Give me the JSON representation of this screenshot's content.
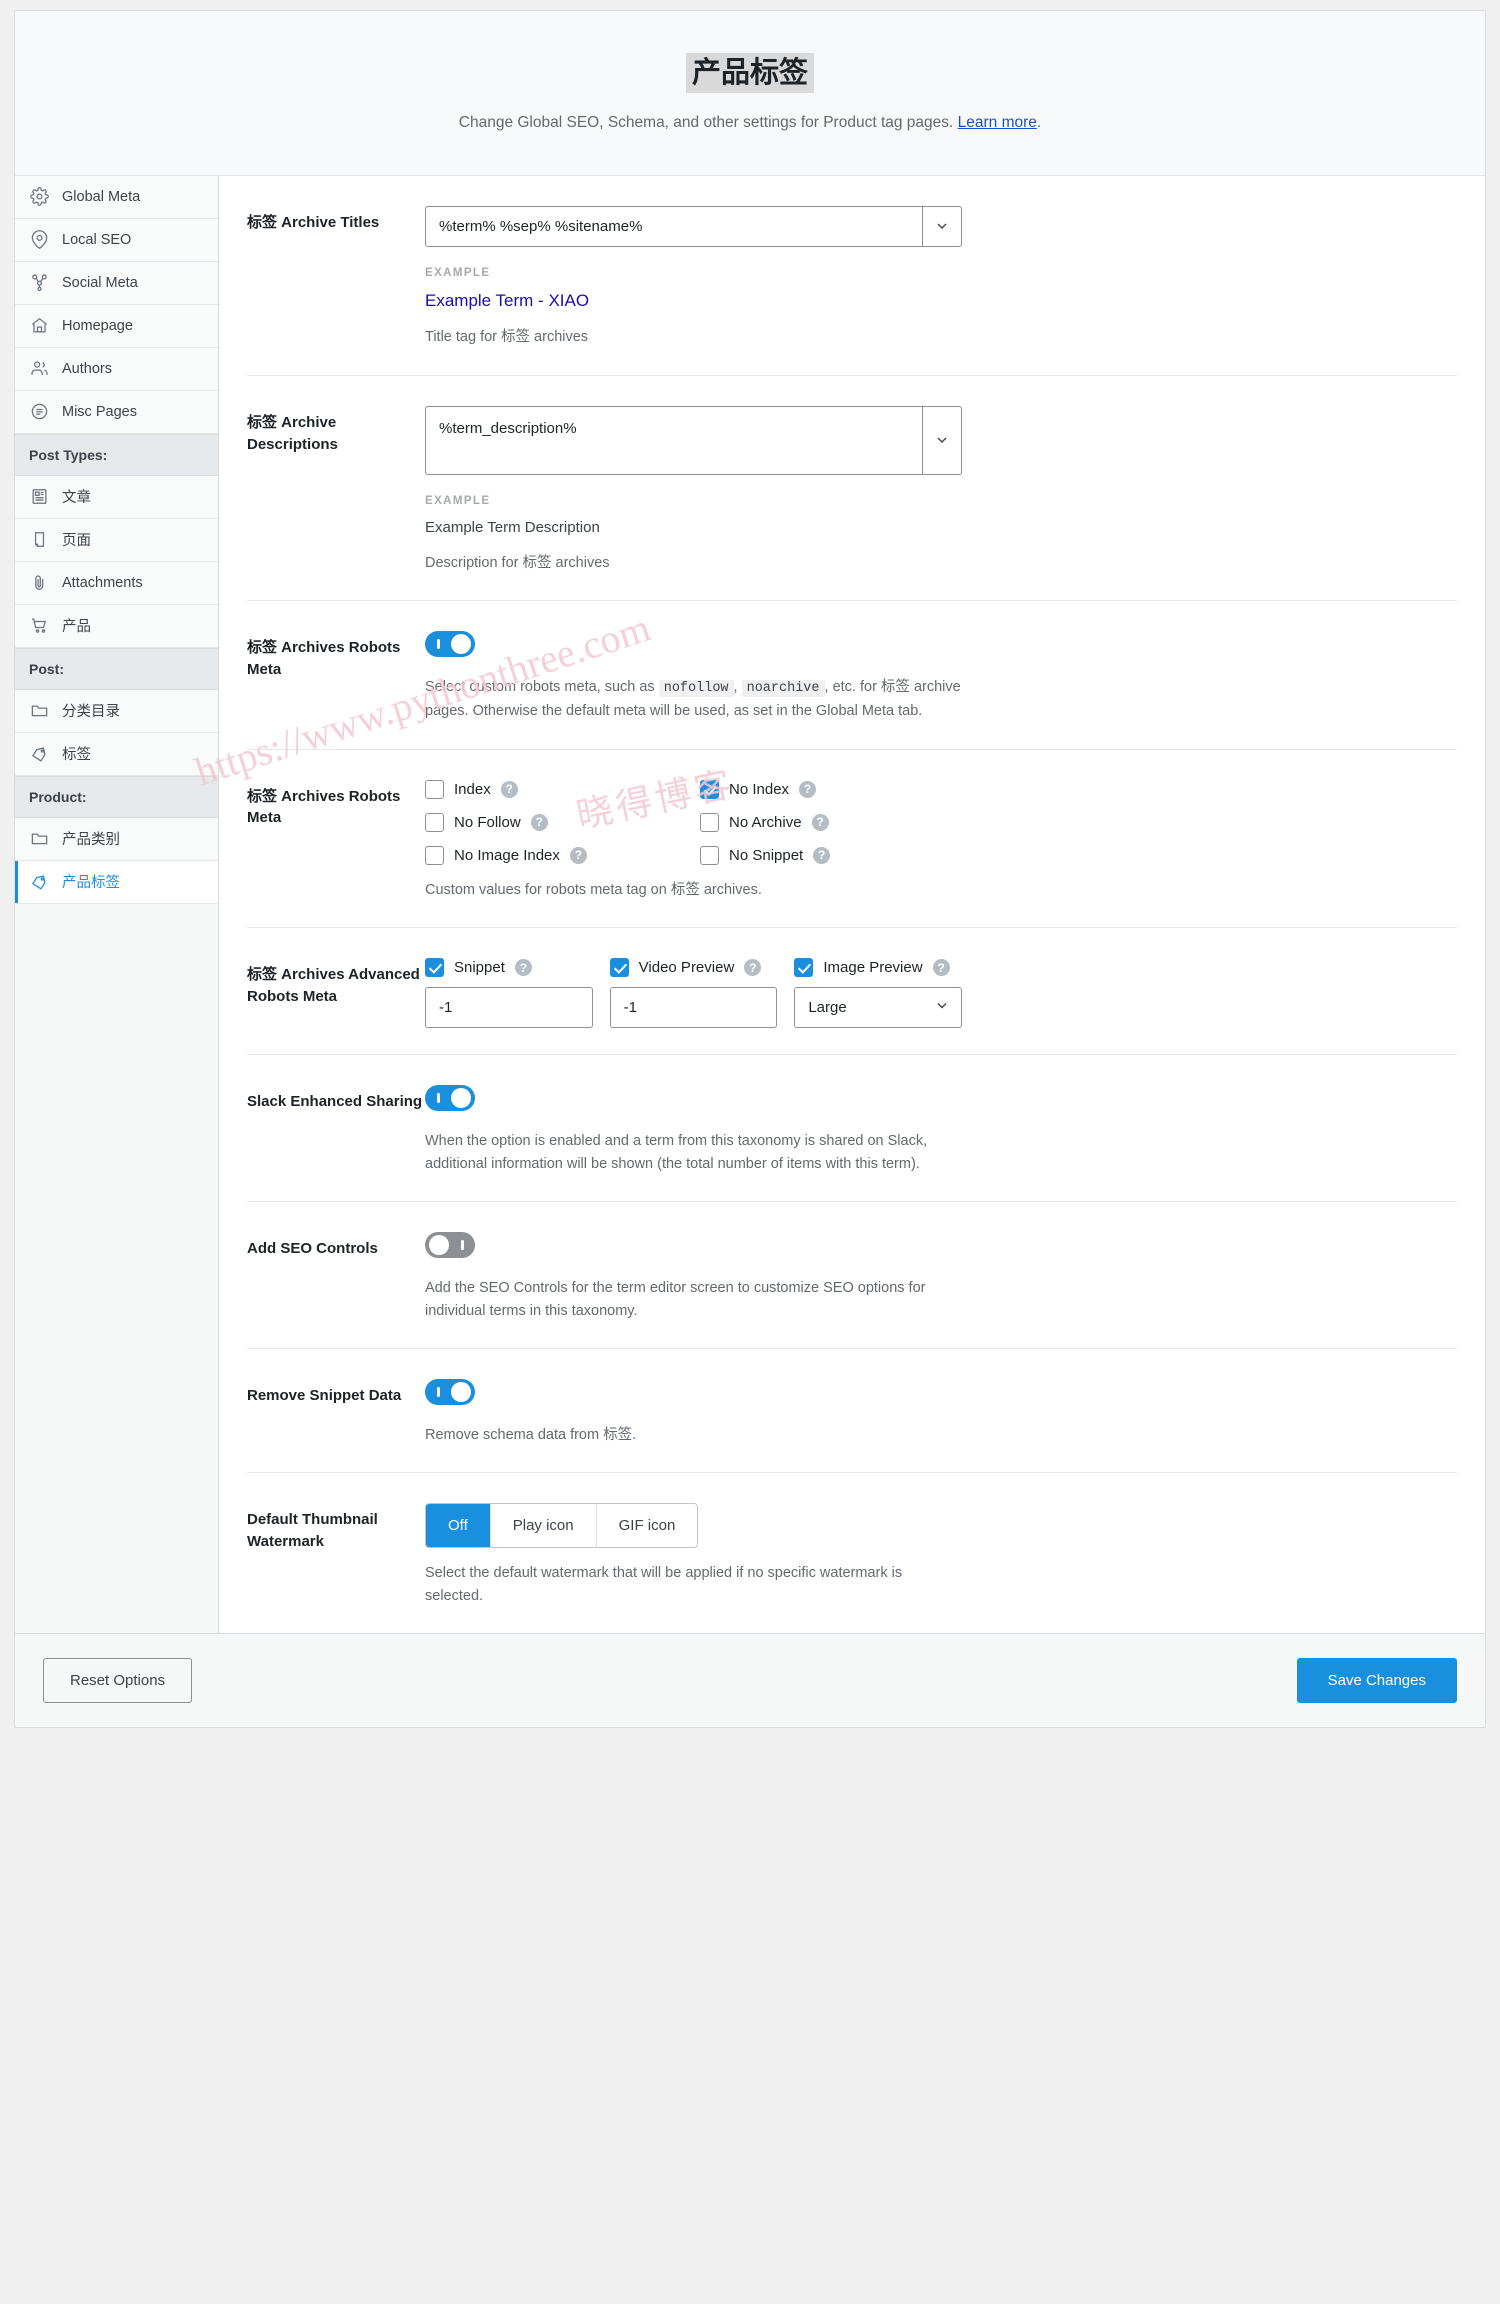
{
  "header": {
    "title": "产品标签",
    "description_prefix": "Change Global SEO, Schema, and other settings for Product tag pages.",
    "learn_more": "Learn more",
    "description_suffix": "."
  },
  "sidebar": {
    "items": [
      {
        "label": "Global Meta",
        "icon": "gear-icon",
        "type": "nav"
      },
      {
        "label": "Local SEO",
        "icon": "location-pin-icon",
        "type": "nav"
      },
      {
        "label": "Social Meta",
        "icon": "share-nodes-icon",
        "type": "nav"
      },
      {
        "label": "Homepage",
        "icon": "home-icon",
        "type": "nav"
      },
      {
        "label": "Authors",
        "icon": "users-icon",
        "type": "nav"
      },
      {
        "label": "Misc Pages",
        "icon": "list-circle-icon",
        "type": "nav"
      },
      {
        "label": "Post Types:",
        "type": "group"
      },
      {
        "label": "文章",
        "icon": "article-icon",
        "type": "nav"
      },
      {
        "label": "页面",
        "icon": "page-icon",
        "type": "nav"
      },
      {
        "label": "Attachments",
        "icon": "paperclip-icon",
        "type": "nav"
      },
      {
        "label": "产品",
        "icon": "cart-icon",
        "type": "nav"
      },
      {
        "label": "Post:",
        "type": "group"
      },
      {
        "label": "分类目录",
        "icon": "folder-icon",
        "type": "nav"
      },
      {
        "label": "标签",
        "icon": "tag-icon",
        "type": "nav"
      },
      {
        "label": "Product:",
        "type": "group"
      },
      {
        "label": "产品类别",
        "icon": "folder-icon",
        "type": "nav"
      },
      {
        "label": "产品标签",
        "icon": "tag-icon",
        "type": "nav",
        "active": true
      }
    ]
  },
  "main": {
    "archive_titles": {
      "label": "标签 Archive Titles",
      "value": "%term% %sep% %sitename%",
      "example_label": "EXAMPLE",
      "example_value": "Example Term - XIAO",
      "hint": "Title tag for 标签 archives"
    },
    "archive_descriptions": {
      "label": "标签 Archive Descriptions",
      "value": "%term_description%",
      "example_label": "EXAMPLE",
      "example_value": "Example Term Description",
      "hint": "Description for 标签 archives"
    },
    "robots_meta_toggle": {
      "label": "标签 Archives Robots Meta",
      "state": "on",
      "hint_part1": "Select custom robots meta, such as",
      "code1": "nofollow",
      "hint_part2": ",",
      "code2": "noarchive",
      "hint_part3": ", etc. for 标签 archive pages. Otherwise the default meta will be used, as set in the Global Meta tab."
    },
    "robots_meta_checks": {
      "label": "标签 Archives Robots Meta",
      "options": [
        {
          "label": "Index",
          "checked": false
        },
        {
          "label": "No Index",
          "checked": true
        },
        {
          "label": "No Follow",
          "checked": false
        },
        {
          "label": "No Archive",
          "checked": false
        },
        {
          "label": "No Image Index",
          "checked": false
        },
        {
          "label": "No Snippet",
          "checked": false
        }
      ],
      "hint": "Custom values for robots meta tag on 标签 archives."
    },
    "advanced_robots": {
      "label": "标签 Archives Advanced Robots Meta",
      "fields": [
        {
          "label": "Snippet",
          "checked": true,
          "value": "-1",
          "kind": "text"
        },
        {
          "label": "Video Preview",
          "checked": true,
          "value": "-1",
          "kind": "text"
        },
        {
          "label": "Image Preview",
          "checked": true,
          "value": "Large",
          "kind": "select"
        }
      ]
    },
    "slack_sharing": {
      "label": "Slack Enhanced Sharing",
      "state": "on",
      "hint": "When the option is enabled and a term from this taxonomy is shared on Slack, additional information will be shown (the total number of items with this term)."
    },
    "seo_controls": {
      "label": "Add SEO Controls",
      "state": "off",
      "hint": "Add the SEO Controls for the term editor screen to customize SEO options for individual terms in this taxonomy."
    },
    "remove_snippet": {
      "label": "Remove Snippet Data",
      "state": "on",
      "hint": "Remove schema data from 标签."
    },
    "watermark": {
      "label": "Default Thumbnail Watermark",
      "options": [
        "Off",
        "Play icon",
        "GIF icon"
      ],
      "selected": "Off",
      "hint": "Select the default watermark that will be applied if no specific watermark is selected."
    }
  },
  "footer": {
    "reset_label": "Reset Options",
    "save_label": "Save Changes"
  },
  "watermark_overlay": {
    "line1": "https://www.pythonthree.com",
    "line2": "晓得博客"
  },
  "colors": {
    "accent": "#1a8fdd",
    "link": "#1a52c4",
    "example_link": "#1a0dab"
  }
}
